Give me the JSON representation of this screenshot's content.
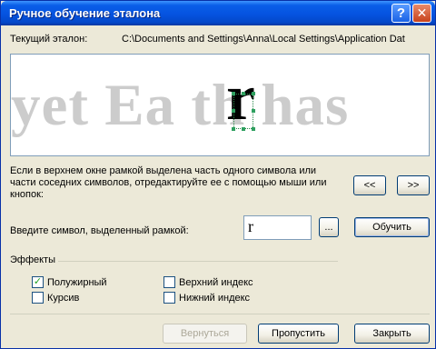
{
  "window": {
    "title": "Ручное обучение эталона",
    "help_glyph": "?",
    "close_glyph": "✕"
  },
  "current_template": {
    "label": "Текущий эталон:",
    "path": "C:\\Documents and Settings\\Anna\\Local Settings\\Application Dat"
  },
  "preview": {
    "text": "yet Ea  th has",
    "selected_char": "r"
  },
  "instructions": "Если в верхнем окне рамкой выделена часть одного символа или части соседних символов, отредактируйте ее с помощью мыши или кнопок:",
  "nav": {
    "prev_label": "<<",
    "next_label": ">>"
  },
  "symbol_input": {
    "label": "Введите символ, выделенный рамкой:",
    "value": "r",
    "browse_label": "...",
    "train_label": "Обучить"
  },
  "effects": {
    "label": "Эффекты",
    "bold": {
      "label": "Полужирный",
      "checked": true
    },
    "italic": {
      "label": "Курсив",
      "checked": false
    },
    "superscript": {
      "label": "Верхний индекс",
      "checked": false
    },
    "subscript": {
      "label": "Нижний индекс",
      "checked": false
    }
  },
  "footer": {
    "back_label": "Вернуться",
    "skip_label": "Пропустить",
    "close_label": "Закрыть"
  }
}
